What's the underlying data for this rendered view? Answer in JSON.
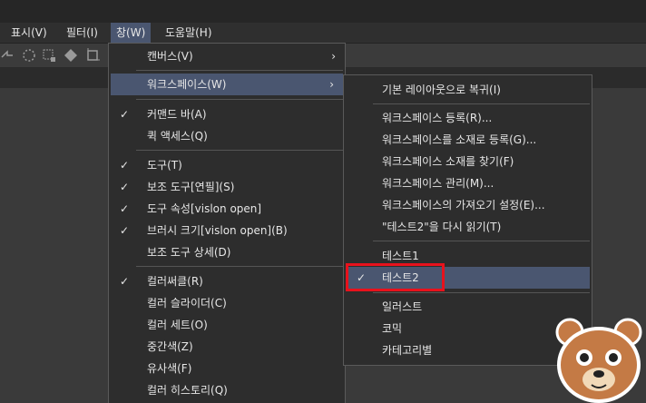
{
  "menubar": {
    "items": [
      {
        "label": "표시(V)"
      },
      {
        "label": "필터(I)"
      },
      {
        "label": "창(W)"
      },
      {
        "label": "도움말(H)"
      }
    ]
  },
  "window_menu": {
    "items": [
      {
        "label": "캔버스(V)",
        "checked": false,
        "submenu": true
      },
      {
        "label": "워크스페이스(W)",
        "checked": false,
        "submenu": true,
        "highlighted": true
      },
      {
        "label": "커맨드 바(A)",
        "checked": true
      },
      {
        "label": "퀵 액세스(Q)",
        "checked": false
      },
      {
        "label": "도구(T)",
        "checked": true
      },
      {
        "label": "보조 도구[연필](S)",
        "checked": true
      },
      {
        "label": "도구 속성[vislon open]",
        "checked": true
      },
      {
        "label": "브러시 크기[vislon open](B)",
        "checked": true
      },
      {
        "label": "보조 도구 상세(D)",
        "checked": false
      },
      {
        "label": "컬러써클(R)",
        "checked": true
      },
      {
        "label": "컬러 슬라이더(C)",
        "checked": false
      },
      {
        "label": "컬러 세트(O)",
        "checked": false
      },
      {
        "label": "중간색(Z)",
        "checked": false
      },
      {
        "label": "유사색(F)",
        "checked": false
      },
      {
        "label": "컬러 히스토리(Q)",
        "checked": false
      }
    ]
  },
  "workspace_submenu": {
    "items": [
      {
        "label": "기본 레이아웃으로 복귀(I)"
      },
      {
        "label": "워크스페이스 등록(R)..."
      },
      {
        "label": "워크스페이스를 소재로 등록(G)..."
      },
      {
        "label": "워크스페이스 소재를 찾기(F)"
      },
      {
        "label": "워크스페이스 관리(M)..."
      },
      {
        "label": "워크스페이스의 가져오기 설정(E)..."
      },
      {
        "label": "\"테스트2\"을 다시 읽기(T)"
      },
      {
        "label": "테스트1",
        "checked": false
      },
      {
        "label": "테스트2",
        "checked": true,
        "highlighted": true
      },
      {
        "label": "일러스트"
      },
      {
        "label": "코믹"
      },
      {
        "label": "카테고리별"
      }
    ]
  },
  "icons": {
    "check": "✓",
    "submenu_arrow": "›"
  },
  "colors": {
    "highlight": "#4a5670",
    "annotation_box": "#e8121c"
  }
}
